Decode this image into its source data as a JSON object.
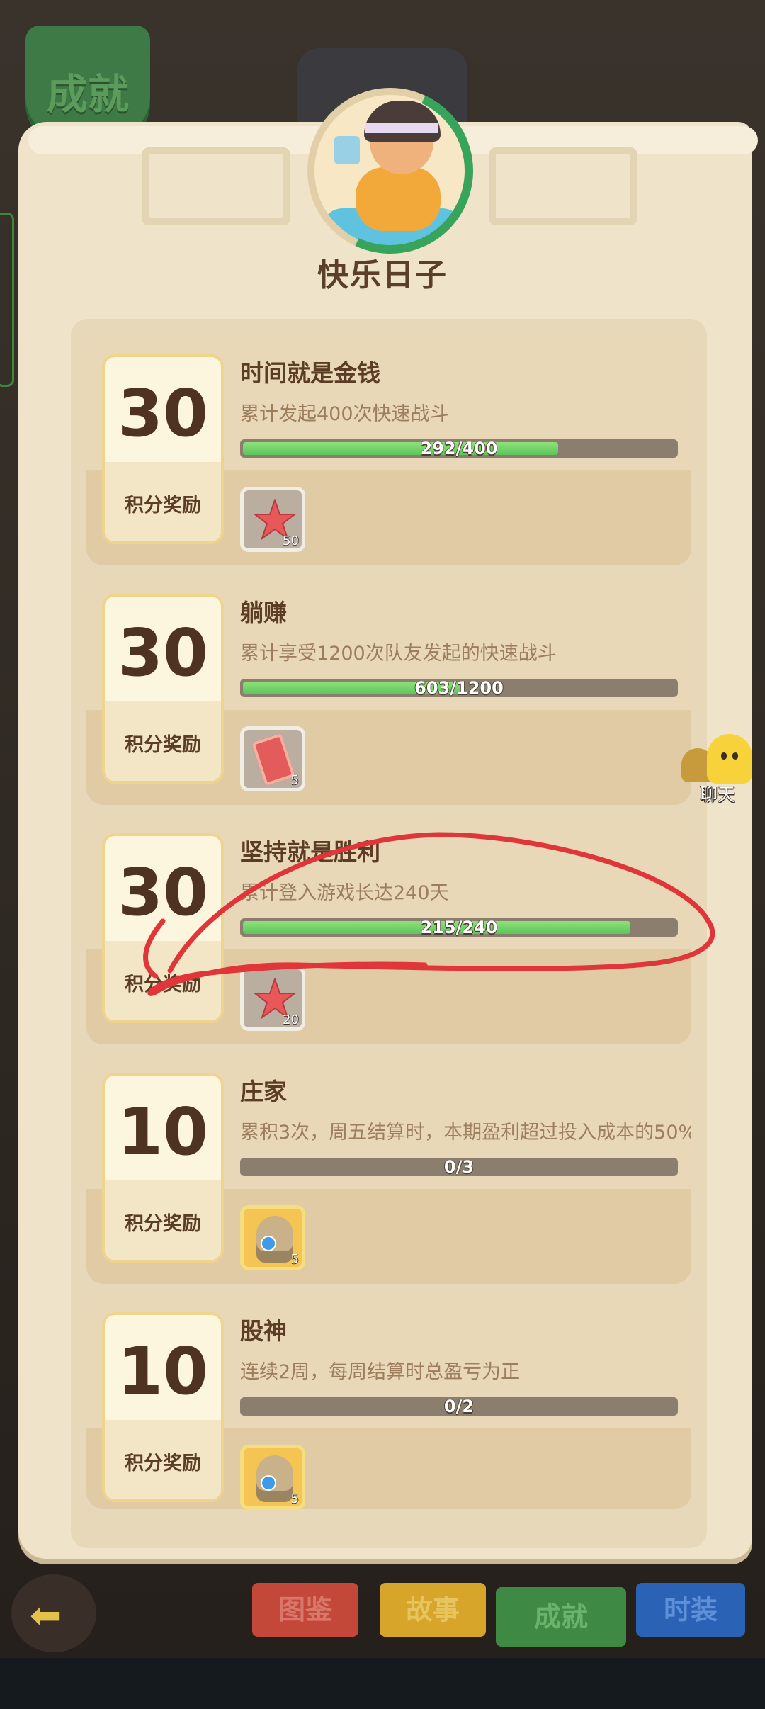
{
  "top_tab": {
    "label": "成就"
  },
  "header": {
    "title": "快乐日子"
  },
  "chat": {
    "label": "聊天"
  },
  "achievements": [
    {
      "points": "30",
      "points_label": "积分奖励",
      "title": "时间就是金钱",
      "desc": "累计发起400次快速战斗",
      "progress": "292/400",
      "progress_fraction": 0.73,
      "reward_icon": "starfish-icon",
      "reward_count": "50"
    },
    {
      "points": "30",
      "points_label": "积分奖励",
      "title": "躺赚",
      "desc": "累计享受1200次队友发起的快速战斗",
      "progress": "603/1200",
      "progress_fraction": 0.5025,
      "reward_icon": "ticket-icon",
      "reward_count": "5"
    },
    {
      "points": "30",
      "points_label": "积分奖励",
      "title": "坚持就是胜利",
      "desc": "累计登入游戏长达240天",
      "progress": "215/240",
      "progress_fraction": 0.896,
      "reward_icon": "starfish-icon",
      "reward_count": "20"
    },
    {
      "points": "10",
      "points_label": "积分奖励",
      "title": "庄家",
      "desc": "累积3次，周五结算时，本期盈利超过投入成本的50%",
      "progress": "0/3",
      "progress_fraction": 0,
      "reward_icon": "statue-icon",
      "reward_count": "5"
    },
    {
      "points": "10",
      "points_label": "积分奖励",
      "title": "股神",
      "desc": "连续2周，每周结算时总盈亏为正",
      "progress": "0/2",
      "progress_fraction": 0,
      "reward_icon": "statue-icon",
      "reward_count": "5"
    }
  ],
  "bottom_nav": {
    "items": [
      {
        "label": "图鉴",
        "color": "#c4483a",
        "text_color": "#d8786a"
      },
      {
        "label": "故事",
        "color": "#d6a52a",
        "text_color": "#e8c460"
      },
      {
        "label": "成就",
        "color": "#3e8a45",
        "text_color": "#6bb36b"
      },
      {
        "label": "时装",
        "color": "#2a62b6",
        "text_color": "#5f8fd6"
      }
    ]
  },
  "colors": {
    "progress_fill": "#6ad46a",
    "annotation": "#e0363a"
  }
}
